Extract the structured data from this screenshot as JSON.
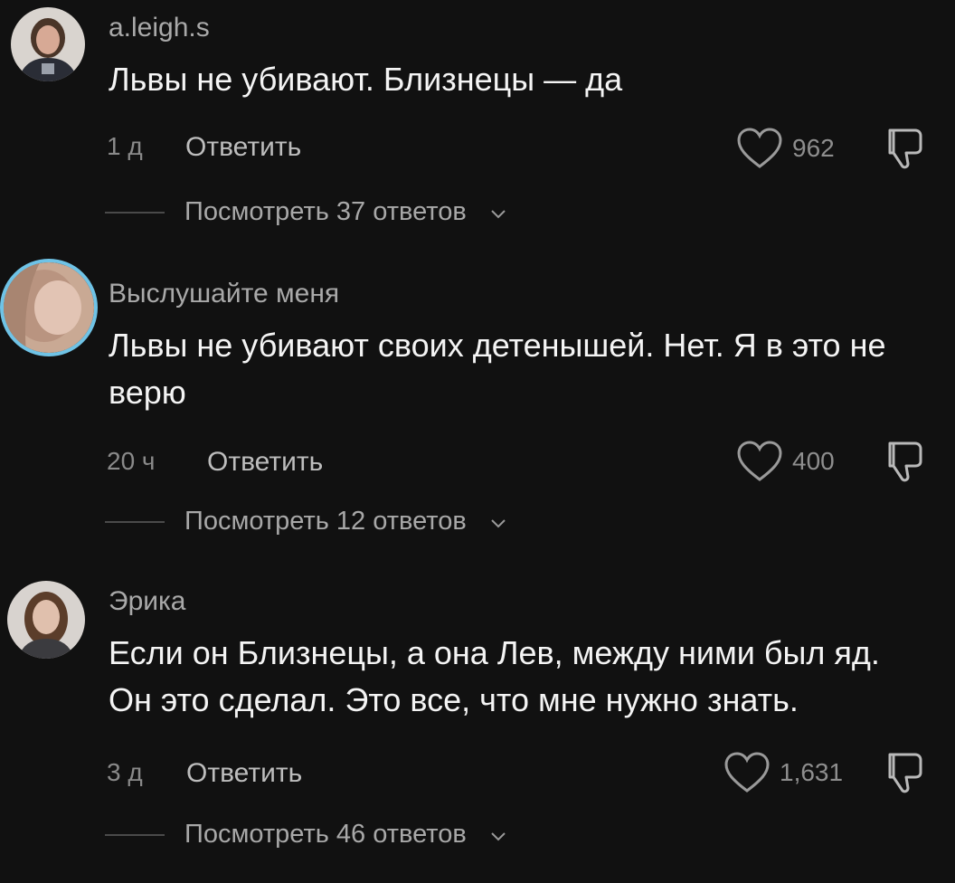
{
  "comments": [
    {
      "username": "a.leigh.s",
      "text": "Львы не убивают. Близнецы — да",
      "time": "1 д",
      "reply_label": "Ответить",
      "likes": "962",
      "view_replies": "Посмотреть 37 ответов"
    },
    {
      "username": "Выслушайте меня",
      "text": "Львы не убивают своих детенышей. Нет. Я в это не верю",
      "time": "20 ч",
      "reply_label": "Ответить",
      "likes": "400",
      "view_replies": "Посмотреть 12 ответов"
    },
    {
      "username": "Эрика",
      "text": "Если он Близнецы, а она Лев, между ними был яд. Он это сделал. Это все, что мне нужно знать.",
      "time": "3 д",
      "reply_label": "Ответить",
      "likes": "1,631",
      "view_replies": "Посмотреть 46 ответов"
    }
  ],
  "icons": {
    "like": "heart-outline-icon",
    "dislike": "thumbs-down-icon",
    "expand": "chevron-down-icon"
  },
  "colors": {
    "background": "#111111",
    "story_ring": "#6fc3e6"
  }
}
